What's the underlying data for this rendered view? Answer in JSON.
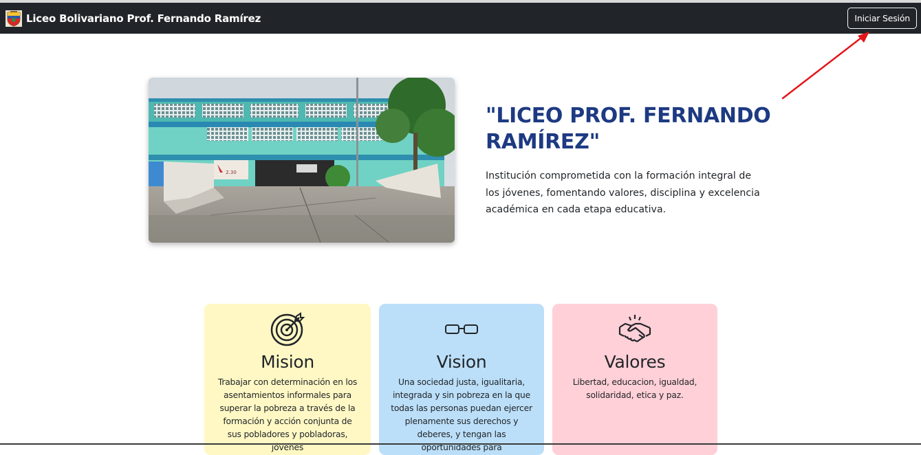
{
  "navbar": {
    "brand_text": "Liceo Bolivariano Prof. Fernando Ramírez",
    "login_label": "Iniciar Sesión",
    "logo_icon": "school-crest-icon"
  },
  "hero": {
    "title": "\"LICEO PROF. FERNANDO RAMÍREZ\"",
    "description": "Institución comprometida con la formación integral de los jóvenes, fomentando valores, disciplina y excelencia académica en cada etapa educativa.",
    "photo_sign_text": "2.30"
  },
  "cards": [
    {
      "title": "Mision",
      "icon": "target-icon",
      "text": "Trabajar con determinación en los asentamientos informales para superar la pobreza a través de la formación y acción conjunta de sus pobladores y pobladoras, jóvenes",
      "color": "#fff8c4"
    },
    {
      "title": "Vision",
      "icon": "glasses-icon",
      "text": "Una sociedad justa, igualitaria, integrada y sin pobreza en la que todas las personas puedan ejercer plenamente sus derechos y deberes, y tengan las oportunidades para",
      "color": "#bcdff9"
    },
    {
      "title": "Valores",
      "icon": "handshake-icon",
      "text": "Libertad, educacion, igualdad, solidaridad, etica y paz.",
      "color": "#ffd0d7"
    }
  ],
  "colors": {
    "navbar_bg": "#212529",
    "title_blue": "#1d3a82",
    "annotation_arrow": "#e3151a"
  }
}
